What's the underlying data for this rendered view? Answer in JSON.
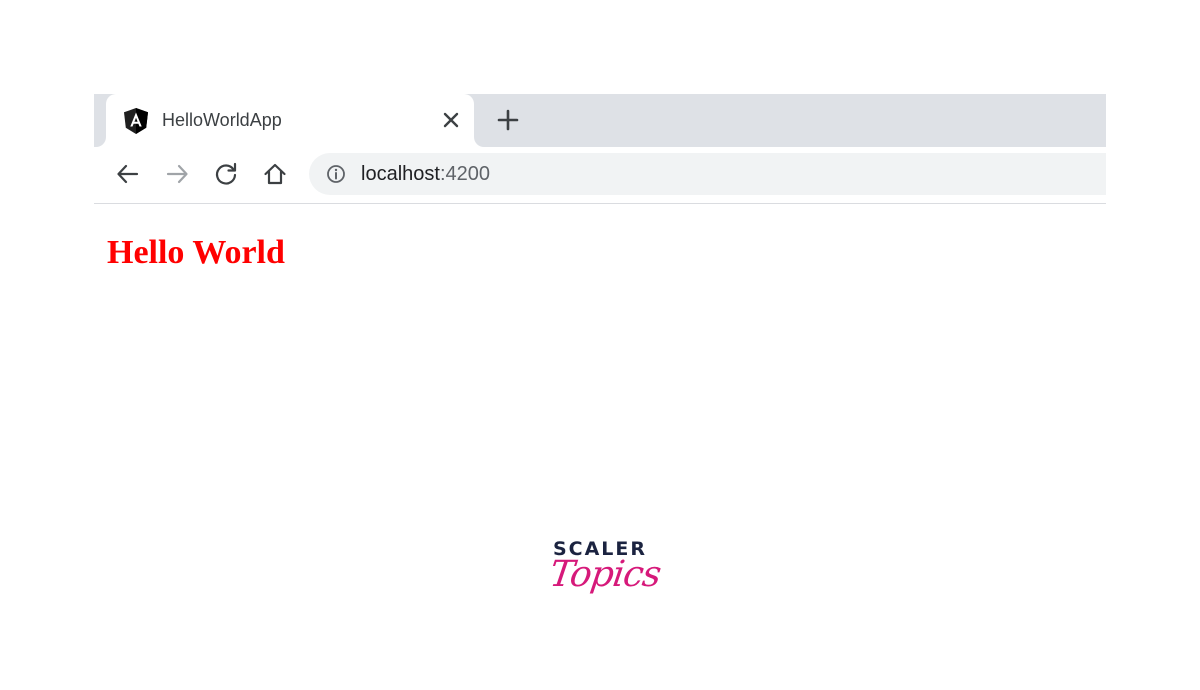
{
  "browser": {
    "tab": {
      "title": "HelloWorldApp",
      "favicon": "angular-logo-icon"
    },
    "new_tab_icon": "plus-icon",
    "toolbar": {
      "back_icon": "arrow-left-icon",
      "forward_icon": "arrow-right-icon",
      "reload_icon": "reload-icon",
      "home_icon": "home-icon"
    },
    "omnibox": {
      "info_icon": "info-icon",
      "host": "localhost",
      "port": ":4200"
    }
  },
  "page": {
    "heading": "Hello World",
    "heading_color": "#ff0000"
  },
  "logo": {
    "line1": "SCALER",
    "line2": "Topics",
    "line1_color": "#1b2340",
    "line2_color": "#d6197a"
  },
  "colors": {
    "tabstrip": "#dee1e6",
    "omnibox": "#f1f3f4"
  }
}
